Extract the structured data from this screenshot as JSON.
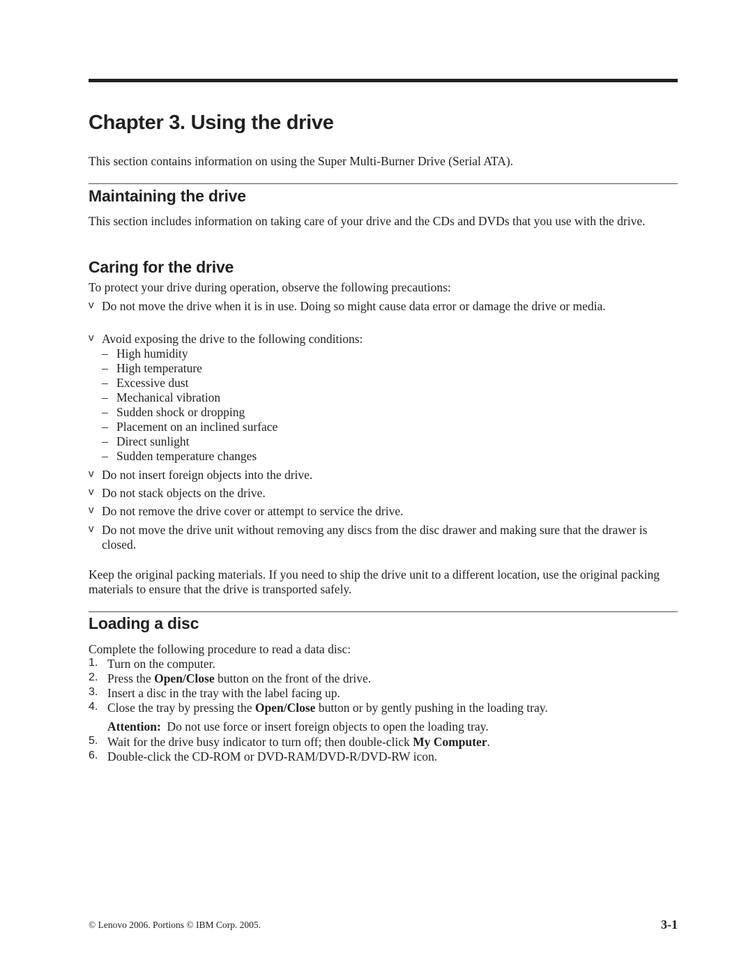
{
  "chapter": {
    "title": "Chapter 3. Using the drive",
    "intro": "This section contains information on using the Super Multi-Burner Drive (Serial ATA)."
  },
  "maintaining": {
    "heading": "Maintaining the drive",
    "body": "This section includes information on taking care of your drive and the CDs and DVDs that you use with the drive."
  },
  "caring": {
    "heading": "Caring for the drive",
    "intro": "To protect your drive during operation, observe the following precautions:",
    "bullet_marker": "v",
    "dash_marker": "–",
    "bullets": [
      "Do not move the drive when it is in use. Doing so might cause data error or damage the drive or media.",
      "Avoid exposing the drive to the following conditions:",
      "Do not insert foreign objects into the drive.",
      "Do not stack objects on the drive.",
      "Do not remove the drive cover or attempt to service the drive.",
      "Do not move the drive unit without removing any discs from the disc drawer and making sure that the drawer is closed."
    ],
    "conditions": [
      "High humidity",
      "High temperature",
      "Excessive dust",
      "Mechanical vibration",
      "Sudden shock or dropping",
      "Placement on an inclined surface",
      "Direct sunlight",
      "Sudden temperature changes"
    ],
    "closing": "Keep the original packing materials. If you need to ship the drive unit to a different location, use the original packing materials to ensure that the drive is transported safely."
  },
  "loading": {
    "heading": "Loading a disc",
    "intro": "Complete the following procedure to read a data disc:",
    "steps": [
      {
        "num": "1.",
        "pre": "Turn on the computer.",
        "bold": "",
        "post": ""
      },
      {
        "num": "2.",
        "pre": "Press the ",
        "bold": "Open/Close",
        "post": " button on the front of the drive."
      },
      {
        "num": "3.",
        "pre": "Insert a disc in the tray with the label facing up.",
        "bold": "",
        "post": ""
      },
      {
        "num": "4.",
        "pre": "Close the tray by pressing the ",
        "bold": "Open/Close",
        "post": " button or by gently pushing in the loading tray."
      },
      {
        "num": "5.",
        "pre": "Wait for the drive busy indicator to turn off; then double-click ",
        "bold": "My Computer",
        "post": "."
      },
      {
        "num": "6.",
        "pre": "Double-click the CD-ROM or DVD-RAM/DVD-R/DVD-RW icon.",
        "bold": "",
        "post": ""
      }
    ],
    "attention_label": "Attention:",
    "attention_text": "Do not use force or insert foreign objects to open the loading tray."
  },
  "footer": {
    "copyright": "© Lenovo 2006. Portions © IBM Corp. 2005.",
    "page_number": "3-1"
  }
}
